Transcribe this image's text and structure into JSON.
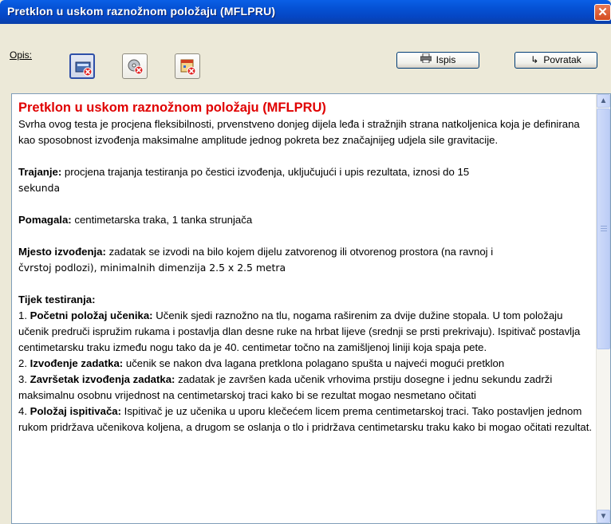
{
  "window": {
    "title": "Pretklon u uskom raznožnom položaju (MFLPRU)",
    "close_glyph": "✕"
  },
  "toolbar": {
    "opis_label": "Opis:",
    "icons": [
      "record-remove-icon",
      "disk-remove-icon",
      "calendar-remove-icon"
    ],
    "print_label": "Ispis",
    "print_icon": "printer-icon",
    "back_label": "Povratak",
    "back_icon": "return-arrow-icon"
  },
  "content": {
    "heading": "Pretklon u uskom raznožnom položaju (MFLPRU)",
    "intro": "Svrha ovog testa je procjena fleksibilnosti, prvenstveno donjeg dijela leđa i stražnjih strana natkoljenica koja je definirana kao sposobnost izvođenja maksimalne amplitude jednog pokreta bez značajnijeg udjela sile gravitacije.",
    "duration_label": "Trajanje:",
    "duration_text1": " procjena trajanja testiranja po čestici izvođenja, uključujući i upis rezultata, iznosi do 15",
    "duration_text2": "sekunda",
    "aids_label": "Pomagala:",
    "aids_text": " centimetarska traka, 1 tanka strunjača",
    "place_label": "Mjesto izvođenja:",
    "place_text1": " zadatak se izvodi na bilo kojem dijelu zatvorenog ili otvorenog prostora (na ravnoj i",
    "place_text2": "čvrstoj podlozi), minimalnih dimenzija 2.5 x 2.5 metra",
    "flow_label": "Tijek testiranja:",
    "steps": [
      {
        "num": "1. ",
        "label": "Početni položaj učenika:",
        "text": " Učenik sjedi raznožno na tlu, nogama raširenim za dvije dužine stopala. U tom položaju učenik predruči ispružim rukama i postavlja dlan desne ruke na hrbat lijeve (srednji se prsti prekrivaju). Ispitivač postavlja centimetarsku traku između nogu tako da je 40. centimetar točno na zamišljenoj liniji koja spaja pete."
      },
      {
        "num": "2. ",
        "label": "Izvođenje zadatka:",
        "text": " učenik se nakon dva lagana pretklona polagano spušta u najveći mogući pretklon"
      },
      {
        "num": "3. ",
        "label": "Završetak izvođenja zadatka:",
        "text": " zadatak je završen kada učenik vrhovima prstiju dosegne i jednu sekundu zadrži maksimalnu osobnu vrijednost na centimetarskoj traci kako bi se rezultat mogao nesmetano očitati"
      },
      {
        "num": "4. ",
        "label": "Položaj ispitivača:",
        "text": " Ispitivač je uz učenika u uporu klečećem licem prema centimetarskoj traci. Tako postavljen jednom rukom pridržava učenikova koljena, a drugom se oslanja o tlo i pridržava centimetarsku traku kako bi mogao očitati rezultat."
      }
    ]
  },
  "scrollbar": {
    "up": "▲",
    "down": "▼"
  }
}
